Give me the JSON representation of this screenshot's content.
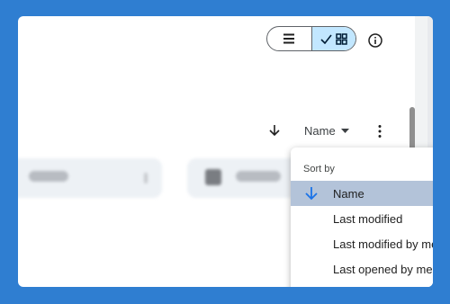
{
  "toolbar": {
    "list_view_icon": "list-icon",
    "grid_view_icon": "grid-icon",
    "checkmark_icon": "check-icon",
    "info_icon": "info-icon"
  },
  "sort": {
    "direction_icon": "arrow-down-icon",
    "label": "Name",
    "dropdown_icon": "caret-down-icon",
    "more_icon": "more-vert-icon"
  },
  "sort_menu": {
    "title": "Sort by",
    "items": [
      {
        "label": "Name",
        "selected": true
      },
      {
        "label": "Last modified",
        "selected": false
      },
      {
        "label": "Last modified by me",
        "selected": false
      },
      {
        "label": "Last opened by me",
        "selected": false
      }
    ]
  },
  "colors": {
    "background": "#2f7ed1",
    "accent": "#1a73e8",
    "selected_bg": "#b3c3d9",
    "toggle_active": "#c2e7ff"
  }
}
